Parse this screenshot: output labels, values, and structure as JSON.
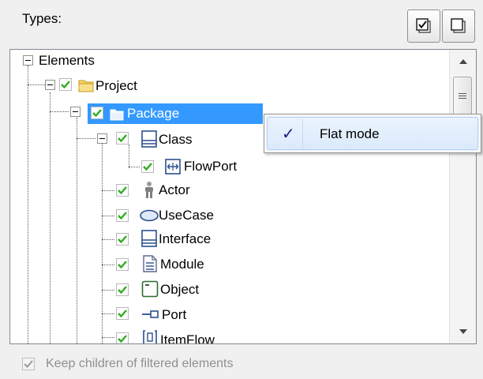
{
  "header": {
    "types_label": "Types:",
    "buttons": [
      {
        "name": "check-all-icon"
      },
      {
        "name": "uncheck-all-icon"
      }
    ]
  },
  "tree": {
    "root": {
      "label": "Elements"
    },
    "items": [
      {
        "label": "Project",
        "icon": "folder-icon",
        "checked": true
      },
      {
        "label": "Package",
        "icon": "package-icon",
        "checked": true,
        "selected": true
      },
      {
        "label": "Class",
        "icon": "class-icon",
        "checked": true
      },
      {
        "label": "FlowPort",
        "icon": "flowport-icon",
        "checked": true
      },
      {
        "label": "Actor",
        "icon": "actor-icon",
        "checked": true
      },
      {
        "label": "UseCase",
        "icon": "usecase-icon",
        "checked": true
      },
      {
        "label": "Interface",
        "icon": "interface-icon",
        "checked": true
      },
      {
        "label": "Module",
        "icon": "module-icon",
        "checked": true
      },
      {
        "label": "Object",
        "icon": "object-icon",
        "checked": true
      },
      {
        "label": "Port",
        "icon": "port-icon",
        "checked": true
      },
      {
        "label": "ItemFlow",
        "icon": "itemflow-icon",
        "checked": true
      }
    ]
  },
  "context_menu": {
    "items": [
      {
        "label": "Flat mode",
        "checked": true
      }
    ]
  },
  "footer": {
    "keep_children_label": "Keep children of filtered elements",
    "keep_children_checked": true,
    "keep_children_disabled": true
  },
  "colors": {
    "selection": "#3399ff",
    "check": "#2fae1f",
    "folder": "#f2c94c"
  }
}
